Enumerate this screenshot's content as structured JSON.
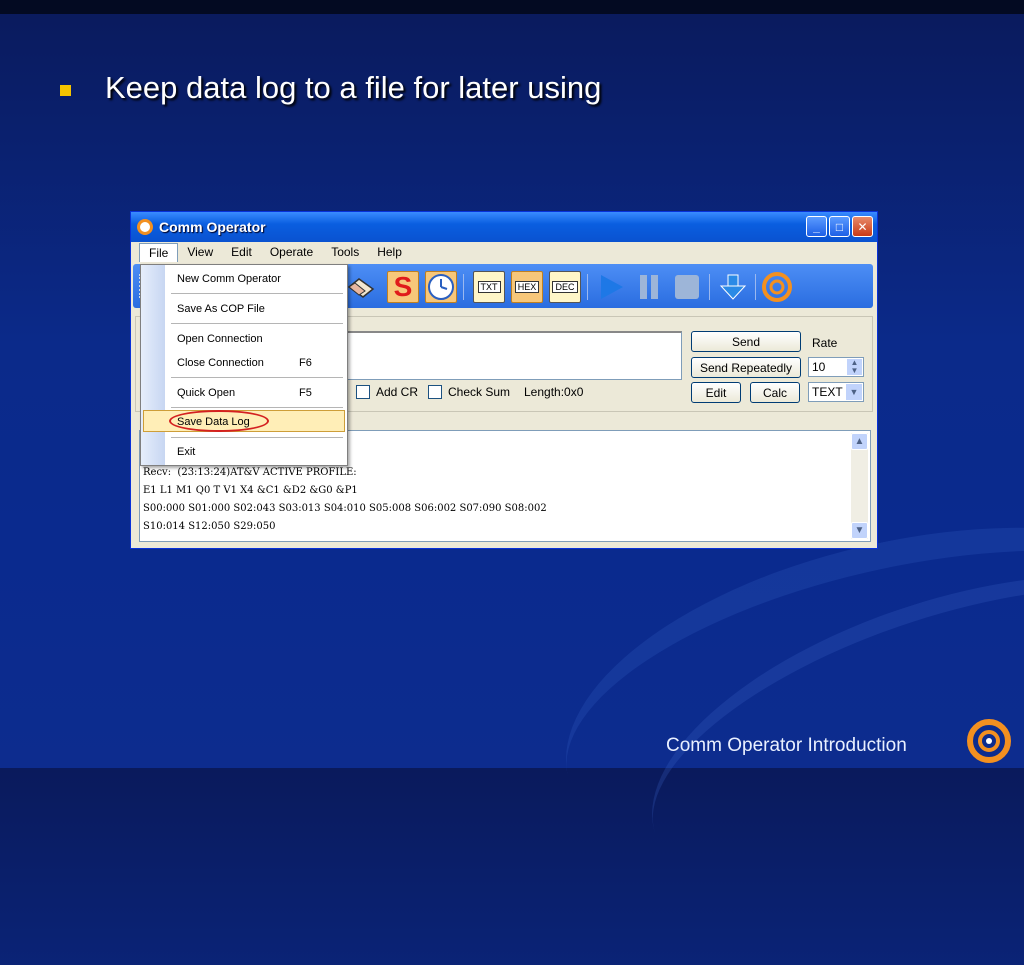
{
  "slide": {
    "bullet": "Keep data log to a file for later using",
    "footer": "Comm Operator Introduction",
    "accent_color": "#f5c400"
  },
  "window": {
    "title": "Comm Operator",
    "controls": [
      "minimize-icon",
      "maximize-icon",
      "close-icon"
    ]
  },
  "menubar": {
    "items": [
      "File",
      "View",
      "Edit",
      "Operate",
      "Tools",
      "Help"
    ],
    "open_item": "File"
  },
  "file_menu": {
    "items": [
      {
        "label": "New Comm Operator",
        "shortcut": ""
      },
      {
        "label": "Save As COP File",
        "shortcut": ""
      },
      {
        "label": "Open Connection",
        "shortcut": ""
      },
      {
        "label": "Close Connection",
        "shortcut": "F6"
      },
      {
        "label": "Quick Open",
        "shortcut": "F5"
      },
      {
        "label": "Save Data Log",
        "shortcut": ""
      },
      {
        "label": "Exit",
        "shortcut": ""
      }
    ],
    "highlighted": "Save Data Log"
  },
  "toolbar": {
    "tools": [
      {
        "name": "eraser-icon",
        "label": ""
      },
      {
        "name": "s-icon",
        "label": "S"
      },
      {
        "name": "clock-icon",
        "label": ""
      },
      {
        "name": "txt-icon",
        "label": "TXT"
      },
      {
        "name": "hex-icon",
        "label": "HEX"
      },
      {
        "name": "dec-icon",
        "label": "DEC"
      },
      {
        "name": "play-icon",
        "label": ""
      },
      {
        "name": "pause-icon",
        "label": ""
      },
      {
        "name": "stop-icon",
        "label": ""
      },
      {
        "name": "down-arrow-icon",
        "label": ""
      },
      {
        "name": "logo-icon",
        "label": ""
      }
    ]
  },
  "send_panel": {
    "send_label": "Send",
    "send_repeatedly_label": "Send Repeatedly",
    "rate_label": "Rate",
    "rate_value": "10",
    "edit_label": "Edit",
    "calc_label": "Calc",
    "format_value": "TEXT",
    "add_cr_label": "Add CR",
    "check_sum_label": "Check Sum",
    "length_label": "Length:0x0"
  },
  "log": {
    "lines": [
      "Recv:  (23:13:24)AT&V ACTIVE PROFILE:",
      "E1 L1 M1 Q0 T V1 X4 &C1 &D2 &G0 &P1",
      "S00:000 S01:000 S02:043 S03:013 S04:010 S05:008 S06:002 S07:090 S08:002",
      "S10:014 S12:050 S29:050"
    ]
  }
}
